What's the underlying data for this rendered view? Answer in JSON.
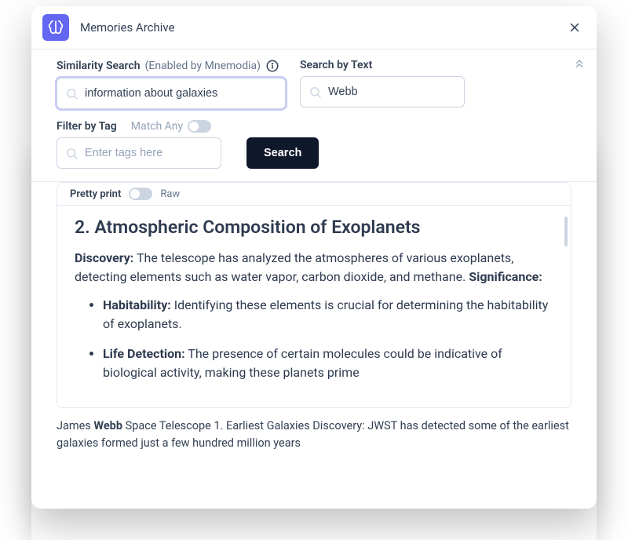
{
  "modal": {
    "title": "Memories Archive"
  },
  "search": {
    "similarity": {
      "label": "Similarity Search",
      "hint": "(Enabled by Mnemodia)",
      "value": "information about galaxies"
    },
    "text": {
      "label": "Search by Text",
      "value": "Webb"
    },
    "tag": {
      "label": "Filter by Tag",
      "match_any": "Match Any",
      "placeholder": "Enter tags here"
    },
    "button": "Search"
  },
  "result": {
    "tab_pretty": "Pretty print",
    "tab_raw": "Raw",
    "heading": "2. Atmospheric Composition of Exoplanets",
    "discovery_label": "Discovery:",
    "discovery_text": " The telescope has analyzed the atmospheres of various exoplanets, detecting elements such as water vapor, carbon dioxide, and methane. ",
    "significance_label": "Significance:",
    "bullets": [
      {
        "label": "Habitability:",
        "text": " Identifying these elements is crucial for determining the habitability of exoplanets."
      },
      {
        "label": "Life Detection:",
        "text": " The presence of certain molecules could be indicative of biological activity, making these planets prime"
      }
    ]
  },
  "excerpt": {
    "pre": "James ",
    "highlight": "Webb",
    "post": " Space Telescope 1. Earliest Galaxies Discovery: JWST has detected some of the earliest galaxies formed just a few hundred million years"
  }
}
